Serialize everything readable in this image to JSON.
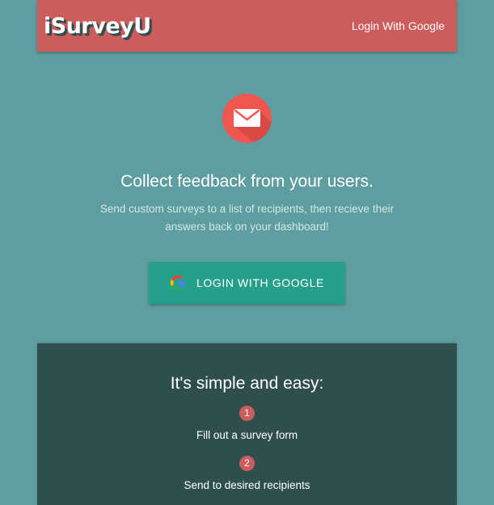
{
  "navbar": {
    "brand": "iSurveyU",
    "login_link": "Login With Google",
    "color": "#cd5c5c"
  },
  "hero": {
    "icon": "envelope-icon",
    "headline": "Collect feedback from your users.",
    "subtext": "Send custom surveys to a list of recipients, then recieve their answers back on your dashboard!",
    "button_label": "LOGIN WITH GOOGLE",
    "button_icon": "google-icon",
    "button_color": "#26a08a"
  },
  "steps_card": {
    "title": "It's simple and easy:",
    "steps": [
      {
        "number": "1",
        "text": "Fill out a survey form"
      },
      {
        "number": "2",
        "text": "Send to desired recipients"
      }
    ],
    "color": "#2f4f4f"
  },
  "background_color": "#5f9ea0"
}
